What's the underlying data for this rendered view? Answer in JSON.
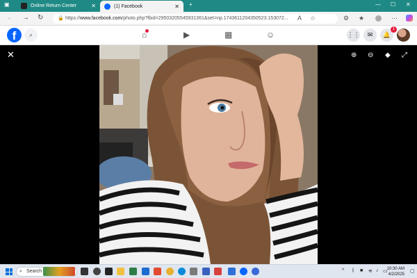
{
  "browser": {
    "tabs": [
      {
        "title": "Online Return Center",
        "favicon": "amazon-icon"
      },
      {
        "title": "(1) Facebook",
        "favicon": "facebook-icon"
      }
    ],
    "url_prefix": "https://",
    "url_domain": "www.facebook.com",
    "url_path": "/photo.php?fbid=29503205545931361&set=np.1743611204350523.153072..."
  },
  "facebook": {
    "logo_letter": "f",
    "notification_count": "1"
  },
  "taskbar": {
    "search_placeholder": "Search",
    "time": "10:30 AM",
    "date": "4/2/2025"
  },
  "colors": {
    "tab_strip": "#1f8a85",
    "facebook_blue": "#0866ff",
    "notification_red": "#e41e3f"
  }
}
